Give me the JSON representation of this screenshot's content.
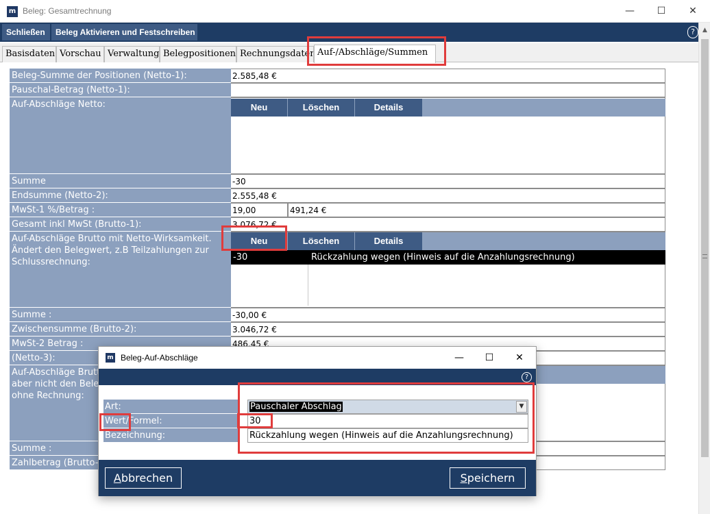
{
  "window": {
    "title": "Beleg: Gesamtrechnung",
    "logo": "m",
    "controls": {
      "minimize": "—",
      "maximize": "☐",
      "close": "✕"
    }
  },
  "toolbar": {
    "close_label": "Schließen",
    "activate_label": "Beleg Aktivieren und Festschreiben",
    "help": "?"
  },
  "tabs": [
    "Basisdaten",
    "Vorschau",
    "Verwaltung",
    "Belegpositionen",
    "Rechnungsdaten",
    "Auf-/Abschläge/Summen"
  ],
  "form": {
    "beleg_summe": {
      "label": "Beleg-Summe der Positionen (Netto-1):",
      "value": "2.585,48 €"
    },
    "pauschal": {
      "label": "Pauschal-Betrag (Netto-1):",
      "value": ""
    },
    "auf_netto": {
      "label": "Auf-Abschläge Netto:"
    },
    "grid_buttons": {
      "new": "Neu",
      "delete": "Löschen",
      "details": "Details"
    },
    "summe1": {
      "label": "Summe",
      "value": "-30"
    },
    "endsumme": {
      "label": "Endsumme (Netto-2):",
      "value": "2.555,48 €"
    },
    "mwst1": {
      "label": "MwSt-1 %/Betrag :",
      "percent": "19,00",
      "amount": "491,24 €"
    },
    "gesamt": {
      "label": "Gesamt inkl MwSt (Brutto-1):",
      "value": "3.076,72 €"
    },
    "auf_brutto": {
      "label_line1": "Auf-Abschläge Brutto mit Netto-Wirksamkeit.",
      "label_line2": "Ändert den Belegwert, z.B Teilzahlungen zur",
      "label_line3": "Schlussrechnung:",
      "row_amount": "-30",
      "row_text": "Rückzahlung wegen (Hinweis auf die Anzahlungsrechnung)"
    },
    "summe2": {
      "label": "Summe :",
      "value": "-30,00 €"
    },
    "zwischensumme": {
      "label": "Zwischensumme (Brutto-2):",
      "value": "3.046,72 €"
    },
    "mwst2": {
      "label": "MwSt-2 Betrag :",
      "value": "486,45 €"
    },
    "netto3": {
      "label": "(Netto-3):"
    },
    "auf_brutto2": {
      "label_line1": "Auf-Abschläge Brutto",
      "label_line2": "aber nicht den Beleg",
      "label_line3": "ohne Rechnung:"
    },
    "summe3": {
      "label": "Summe :"
    },
    "zahlbetrag": {
      "label": "Zahlbetrag (Brutto-3"
    }
  },
  "dialog": {
    "title": "Beleg-Auf-Abschläge",
    "logo": "m",
    "controls": {
      "minimize": "—",
      "maximize": "☐",
      "close": "✕"
    },
    "help": "?",
    "art": {
      "label": "Art:",
      "value": "Pauschaler Abschlag"
    },
    "wert": {
      "label": "Wert/Formel:",
      "value": "30"
    },
    "bezeichnung": {
      "label": "Bezeichnung:",
      "value": "Rückzahlung wegen (Hinweis auf die Anzahlungsrechnung)"
    },
    "cancel": {
      "access_key": "A",
      "rest": "bbrechen"
    },
    "save": {
      "access_key": "S",
      "rest": "peichern"
    }
  },
  "colors": {
    "navy": "#1e3c64",
    "button": "#3e5b84",
    "label_bg": "#8ca0be",
    "highlight": "#e03c3c"
  }
}
